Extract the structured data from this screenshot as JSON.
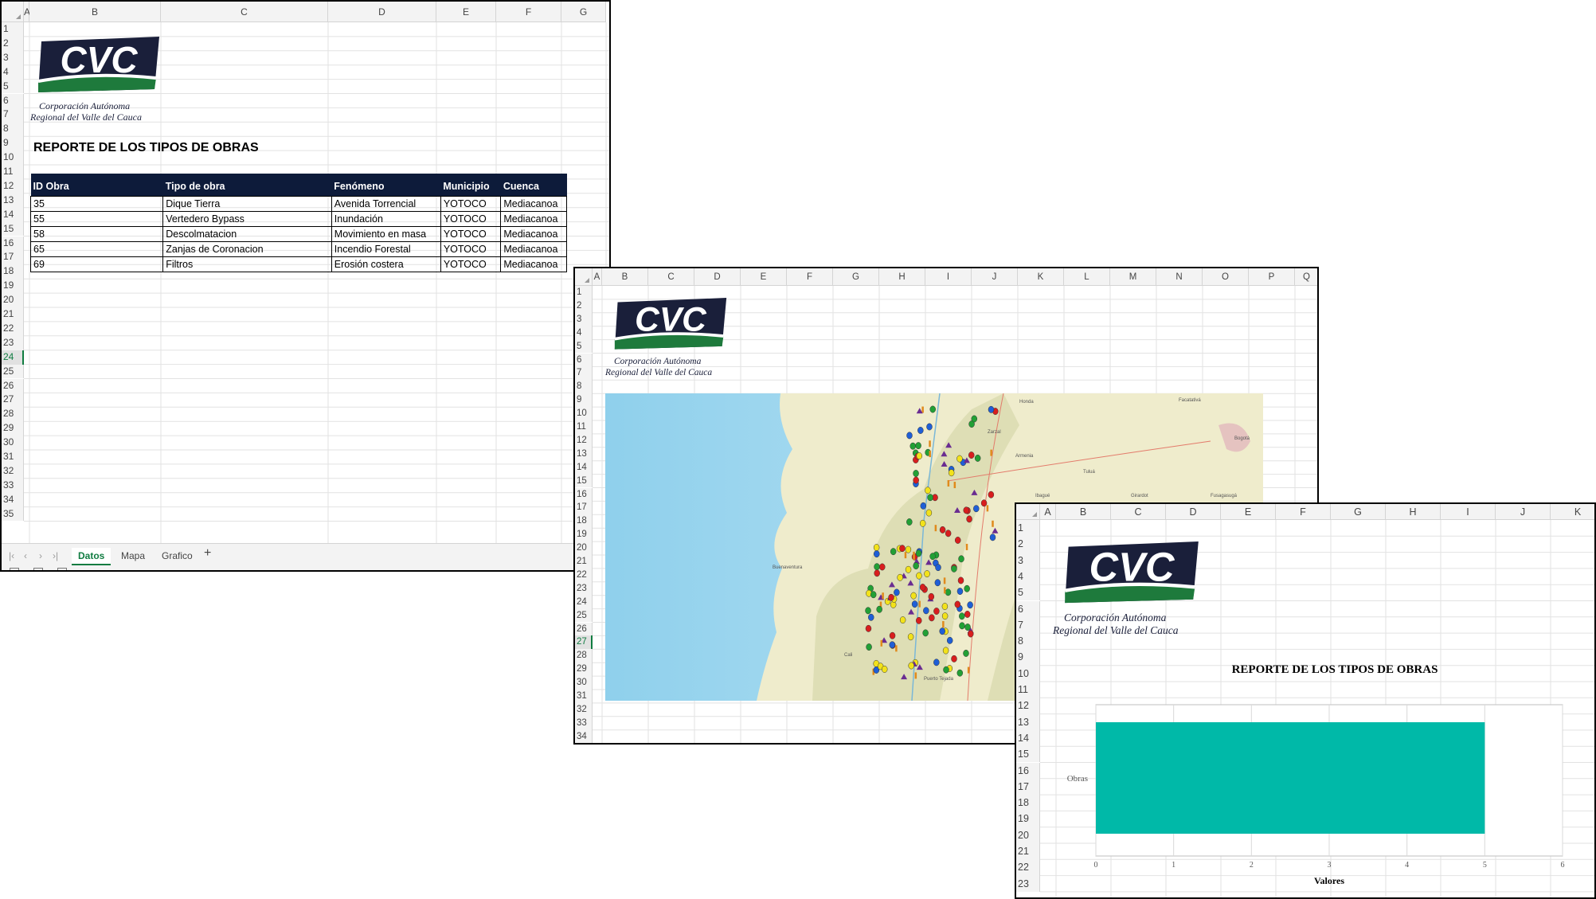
{
  "colors": {
    "header_bg": "#0d1b3a",
    "logo_navy": "#1a1f3a",
    "logo_green": "#1e7a3c",
    "bar": "#00b9a8",
    "accent": "#107c41"
  },
  "logo": {
    "text": "CVC",
    "line1": "Corporación Autónoma",
    "line2": "Regional del Valle del Cauca"
  },
  "sheet1": {
    "columns": [
      "A",
      "B",
      "C",
      "D",
      "E",
      "F",
      "G"
    ],
    "rows": [
      "1",
      "2",
      "3",
      "4",
      "5",
      "6",
      "7",
      "8",
      "9",
      "10",
      "11",
      "12",
      "13",
      "14",
      "15",
      "16",
      "17",
      "18",
      "19",
      "20",
      "21",
      "22",
      "23",
      "24",
      "25",
      "26",
      "27",
      "28",
      "29",
      "30",
      "31",
      "32",
      "33",
      "34",
      "35"
    ],
    "selected_row": "24",
    "report_title": "REPORTE DE LOS TIPOS DE OBRAS",
    "table": {
      "headers": [
        "ID Obra",
        "Tipo de obra",
        "Fenómeno",
        "Municipio",
        "Cuenca"
      ],
      "rows": [
        [
          "35",
          "Dique Tierra",
          "Avenida Torrencial",
          "YOTOCO",
          "Mediacanoa"
        ],
        [
          "55",
          "Vertedero Bypass",
          "Inundación",
          "YOTOCO",
          "Mediacanoa"
        ],
        [
          "58",
          "Descolmatacion",
          "Movimiento en masa",
          "YOTOCO",
          "Mediacanoa"
        ],
        [
          "65",
          "Zanjas de Coronacion",
          "Incendio Forestal",
          "YOTOCO",
          "Mediacanoa"
        ],
        [
          "69",
          "Filtros",
          "Erosión costera",
          "YOTOCO",
          "Mediacanoa"
        ]
      ]
    },
    "tabs": [
      "Datos",
      "Mapa",
      "Grafico"
    ],
    "active_tab": "Datos",
    "add_tab": "+"
  },
  "sheet2": {
    "columns": [
      "A",
      "B",
      "C",
      "D",
      "E",
      "F",
      "G",
      "H",
      "I",
      "J",
      "K",
      "L",
      "M",
      "N",
      "O",
      "P",
      "Q"
    ],
    "rows": [
      "1",
      "2",
      "3",
      "4",
      "5",
      "6",
      "7",
      "8",
      "9",
      "10",
      "11",
      "12",
      "13",
      "14",
      "15",
      "16",
      "17",
      "18",
      "19",
      "20",
      "21",
      "22",
      "23",
      "24",
      "25",
      "26",
      "27",
      "28",
      "29",
      "30",
      "31",
      "32",
      "33",
      "34"
    ],
    "selected_row": "27",
    "map": {
      "place_labels": [
        "Bogotá",
        "Tuluá",
        "Buenaventura",
        "Girardot",
        "Fusagasugá",
        "Armenia",
        "Ibagué",
        "Honda",
        "Facatativá",
        "Cali",
        "Puerto Tejada",
        "Zarzal"
      ],
      "marker_colors": [
        "#d81e1e",
        "#1f5fd6",
        "#22a035",
        "#f2e21b",
        "#6a2c91",
        "#e08a1c"
      ]
    }
  },
  "sheet3": {
    "columns": [
      "A",
      "B",
      "C",
      "D",
      "E",
      "F",
      "G",
      "H",
      "I",
      "J",
      "K"
    ],
    "rows": [
      "1",
      "2",
      "3",
      "4",
      "5",
      "6",
      "7",
      "8",
      "9",
      "10",
      "11",
      "12",
      "13",
      "14",
      "15",
      "16",
      "17",
      "18",
      "19",
      "20",
      "21",
      "22",
      "23"
    ],
    "chart_data": {
      "type": "bar",
      "orientation": "horizontal",
      "title": "REPORTE DE LOS TIPOS DE OBRAS",
      "categories": [
        "Obras"
      ],
      "values": [
        5
      ],
      "xlabel": "Valores",
      "ylabel": "",
      "xlim": [
        0,
        6
      ],
      "xticks": [
        "0",
        "1",
        "2",
        "3",
        "4",
        "5",
        "6"
      ],
      "grid": true,
      "legend": "none"
    }
  }
}
